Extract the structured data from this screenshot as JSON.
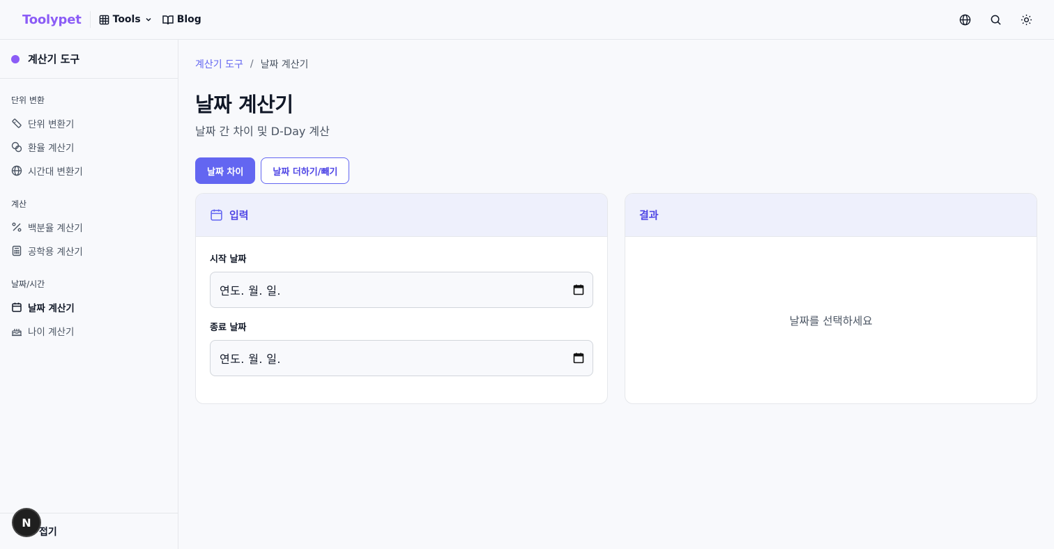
{
  "header": {
    "logo": "Toolypet",
    "nav": [
      {
        "label": "Tools",
        "icon": "grid-icon"
      },
      {
        "label": "Blog",
        "icon": "book-icon"
      }
    ],
    "actions": [
      "globe-icon",
      "search-icon",
      "sun-icon"
    ]
  },
  "sidebar": {
    "title": "계산기 도구",
    "groups": [
      {
        "label": "단위 변환",
        "items": [
          {
            "label": "단위 변환기",
            "icon": "ruler-icon"
          },
          {
            "label": "환율 계산기",
            "icon": "coins-icon"
          },
          {
            "label": "시간대 변환기",
            "icon": "globe-icon"
          }
        ]
      },
      {
        "label": "계산",
        "items": [
          {
            "label": "백분율 계산기",
            "icon": "percent-icon"
          },
          {
            "label": "공학용 계산기",
            "icon": "calculator-icon"
          }
        ]
      },
      {
        "label": "날짜/시간",
        "items": [
          {
            "label": "날짜 계산기",
            "icon": "calendar-icon",
            "active": true
          },
          {
            "label": "나이 계산기",
            "icon": "cake-icon"
          }
        ]
      }
    ],
    "footer": "접기",
    "badge": "N"
  },
  "breadcrumb": {
    "parent": "계산기 도구",
    "separator": "/",
    "current": "날짜 계산기"
  },
  "page": {
    "title": "날짜 계산기",
    "subtitle": "날짜 간 차이 및 D-Day 계산"
  },
  "tabs": [
    {
      "label": "날짜 차이",
      "active": true
    },
    {
      "label": "날짜 더하기/빼기",
      "active": false
    }
  ],
  "input_panel": {
    "title": "입력",
    "start_label": "시작 날짜",
    "start_value": "연도. 월. 일.",
    "end_label": "종료 날짜",
    "end_value": "연도. 월. 일."
  },
  "result_panel": {
    "title": "결과",
    "empty": "날짜를 선택하세요"
  },
  "colors": {
    "accent": "#6366f1",
    "logo": "#8b5cf6",
    "panel_header": "#eef0fc"
  }
}
